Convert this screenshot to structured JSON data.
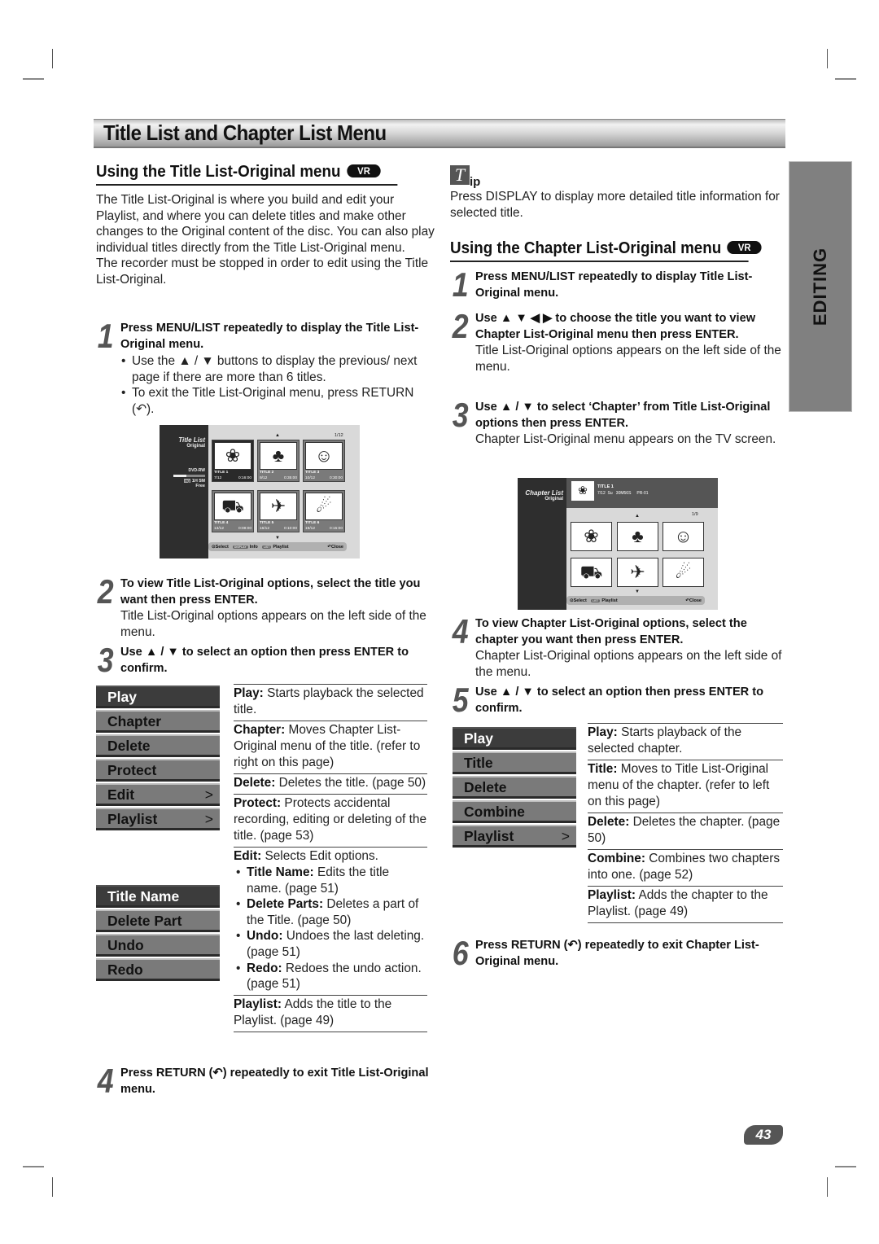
{
  "page": {
    "banner_title": "Title List and Chapter List Menu",
    "side_tab": "EDITING",
    "page_number": "43",
    "vr_badge": "VR"
  },
  "left": {
    "heading": "Using the Title List-Original menu",
    "intro": [
      "The Title List-Original is where you build and edit your Playlist, and where you can delete titles and make other changes to the Original content of the disc. You can also play individual titles directly from the Title List-Original menu.",
      "The recorder must be stopped in order to edit using the Title List-Original."
    ],
    "steps": [
      {
        "num": "1",
        "bold": "Press MENU/LIST repeatedly to display the Title List-Original menu.",
        "text": "",
        "bullets": [
          "Use the ▲ / ▼ buttons to display the previous/ next page if there are more than 6 titles.",
          "To exit the Title List-Original menu, press RETURN (↶)."
        ]
      },
      {
        "num": "2",
        "bold": "To view Title List-Original options, select the title you want then press ENTER.",
        "text": "Title List-Original options appears on the left side of the menu."
      },
      {
        "num": "3",
        "bold": "Use ▲ / ▼ to select an option then press ENTER to confirm.",
        "text": ""
      },
      {
        "num": "4",
        "bold": "Press RETURN (↶) repeatedly to exit Title List-Original menu.",
        "text": ""
      }
    ],
    "osd": {
      "title": "Title List",
      "subtitle": "Original",
      "disc": "DVD-RW",
      "quality": "HQ",
      "free_time": "1H 5M",
      "free_label": "Free",
      "disc_usage_fraction": 0.4,
      "page": "1/12",
      "thumbs": [
        {
          "name": "TITLE 1",
          "date": "7/12",
          "dur": "0:16:00",
          "icon": "rose",
          "selected": true
        },
        {
          "name": "TITLE 2",
          "date": "9/12",
          "dur": "0:35:00",
          "icon": "tree"
        },
        {
          "name": "TITLE 3",
          "date": "10/12",
          "dur": "0:30:00",
          "icon": "figure"
        },
        {
          "name": "TITLE 4",
          "date": "13/12",
          "dur": "0:08:00",
          "icon": "car"
        },
        {
          "name": "TITLE 5",
          "date": "16/12",
          "dur": "0:10:00",
          "icon": "shuttle"
        },
        {
          "name": "TITLE 6",
          "date": "19/12",
          "dur": "0:15:00",
          "icon": "diver"
        }
      ],
      "bar": {
        "select": "Select",
        "display_key": "DISPLAY",
        "info": "Info",
        "list_key": "LIST",
        "playlist": "Playlist",
        "close": "Close"
      }
    },
    "menu": [
      {
        "label": "Play",
        "selected": true,
        "arrow": ""
      },
      {
        "label": "Chapter",
        "arrow": ""
      },
      {
        "label": "Delete",
        "arrow": ""
      },
      {
        "label": "Protect",
        "arrow": ""
      },
      {
        "label": "Edit",
        "arrow": ">"
      },
      {
        "label": "Playlist",
        "arrow": ">"
      }
    ],
    "submenu": [
      {
        "label": "Title Name",
        "selected": true
      },
      {
        "label": "Delete Part"
      },
      {
        "label": "Undo"
      },
      {
        "label": "Redo"
      }
    ],
    "descriptions": [
      {
        "term": "Play:",
        "text": " Starts playback the selected title."
      },
      {
        "term": "Chapter:",
        "text": " Moves Chapter List-Original menu of the title. (refer to right on this page)"
      },
      {
        "term": "Delete:",
        "text": " Deletes the title. (page 50)"
      },
      {
        "term": "Protect:",
        "text": " Protects accidental recording, editing or deleting of the title. (page 53)"
      },
      {
        "term": "Edit:",
        "text": " Selects Edit options.",
        "bullets": [
          {
            "term": "Title Name:",
            "text": " Edits the title name. (page 51)"
          },
          {
            "term": "Delete Parts:",
            "text": " Deletes a part of the Title. (page 50)"
          },
          {
            "term": "Undo:",
            "text": " Undoes the last deleting. (page 51)"
          },
          {
            "term": "Redo:",
            "text": " Redoes the undo action. (page 51)"
          }
        ]
      },
      {
        "term": "Playlist:",
        "text": " Adds the title to the Playlist. (page 49)"
      }
    ]
  },
  "right": {
    "tip_icon": "T",
    "tip_label": "ip",
    "tip_text": "Press DISPLAY to display more detailed title information for selected title.",
    "heading": "Using the Chapter List-Original menu",
    "steps": [
      {
        "num": "1",
        "bold": "Press MENU/LIST repeatedly to display Title List-Original menu.",
        "text": ""
      },
      {
        "num": "2",
        "bold": "Use ▲ ▼ ◀ ▶ to choose the title you want to view Chapter List-Original menu then press ENTER.",
        "text": "Title List-Original options appears on the left side of the menu."
      },
      {
        "num": "3",
        "bold": "Use ▲ / ▼ to select ‘Chapter’ from Title List-Original options then press ENTER.",
        "text": "Chapter List-Original menu appears on the TV screen."
      },
      {
        "num": "4",
        "bold": "To view Chapter List-Original options, select the chapter you want then press ENTER.",
        "text": "Chapter List-Original options appears on the left side of the menu."
      },
      {
        "num": "5",
        "bold": "Use ▲ / ▼ to select an option then press ENTER to confirm.",
        "text": ""
      },
      {
        "num": "6",
        "bold": "Press RETURN (↶) repeatedly to exit Chapter List-Original menu.",
        "text": ""
      }
    ],
    "osd": {
      "title": "Chapter List",
      "subtitle": "Original",
      "info_title": "TITLE 1",
      "info_line": "7/12  Su   30M56S     PR-01",
      "page": "1/9",
      "thumbs": [
        "rose",
        "tree",
        "figure",
        "car",
        "shuttle",
        "diver"
      ],
      "bar": {
        "select": "Select",
        "list_key": "LIST",
        "playlist": "Playlist",
        "close": "Close"
      }
    },
    "menu": [
      {
        "label": "Play",
        "selected": true,
        "arrow": ""
      },
      {
        "label": "Title",
        "arrow": ""
      },
      {
        "label": "Delete",
        "arrow": ""
      },
      {
        "label": "Combine",
        "arrow": ""
      },
      {
        "label": "Playlist",
        "arrow": ">"
      }
    ],
    "descriptions": [
      {
        "term": "Play:",
        "text": " Starts playback of the selected chapter."
      },
      {
        "term": "Title:",
        "text": " Moves to Title List-Original menu of the chapter. (refer to left on this page)"
      },
      {
        "term": "Delete:",
        "text": " Deletes the chapter. (page 50)"
      },
      {
        "term": "Combine:",
        "text": " Combines two chapters into one. (page 52)"
      },
      {
        "term": "Playlist:",
        "text": " Adds the chapter to the Playlist. (page 49)"
      }
    ]
  }
}
